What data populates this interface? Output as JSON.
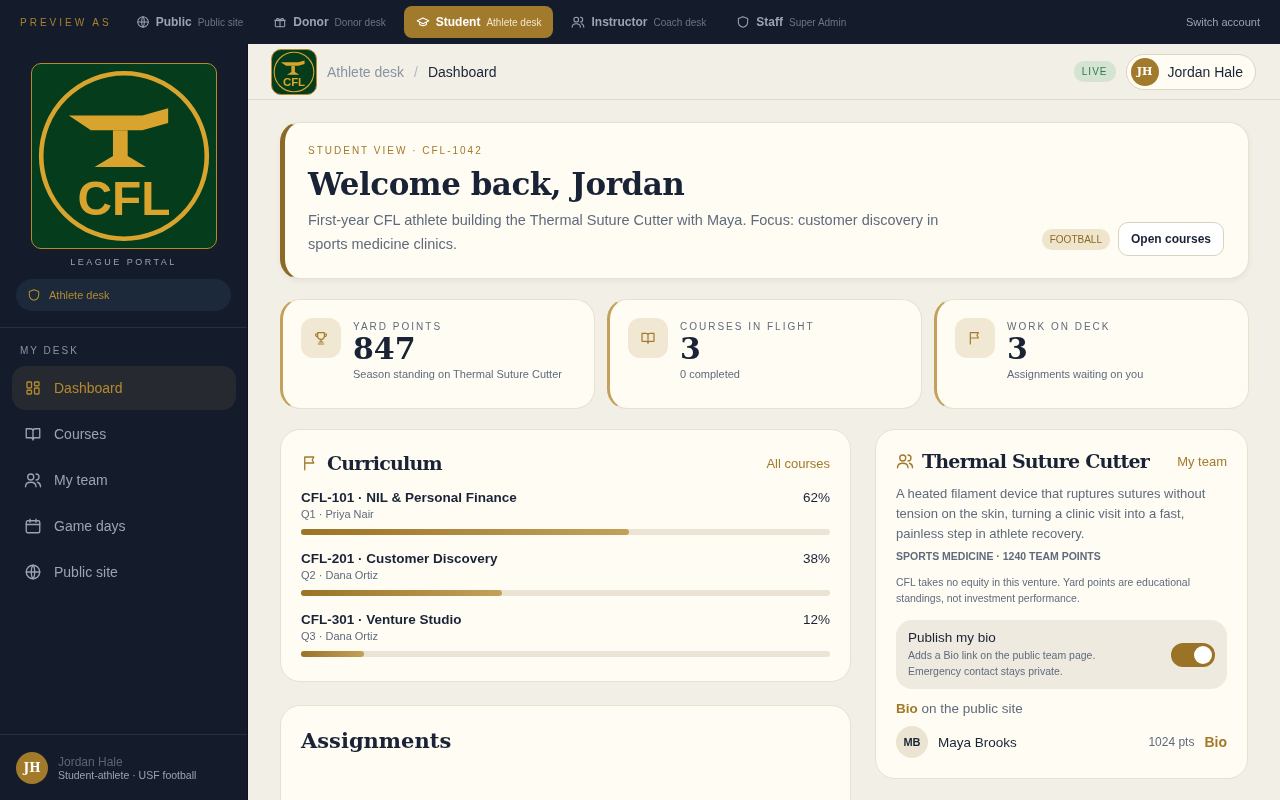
{
  "preview_bar": {
    "label": "PREVIEW AS",
    "roles": [
      {
        "name": "Public",
        "desk": "Public site",
        "selected": false
      },
      {
        "name": "Donor",
        "desk": "Donor desk",
        "selected": false
      },
      {
        "name": "Student",
        "desk": "Athlete desk",
        "selected": true
      },
      {
        "name": "Instructor",
        "desk": "Coach desk",
        "selected": false
      },
      {
        "name": "Staff",
        "desk": "Super Admin",
        "selected": false
      }
    ],
    "switch": "Switch account"
  },
  "sidebar": {
    "logo_text": "CFL",
    "portal": "LEAGUE PORTAL",
    "desk_pill": "Athlete desk",
    "section": "MY DESK",
    "items": [
      {
        "label": "Dashboard",
        "selected": true
      },
      {
        "label": "Courses",
        "selected": false
      },
      {
        "label": "My team",
        "selected": false
      },
      {
        "label": "Game days",
        "selected": false
      },
      {
        "label": "Public site",
        "selected": false
      }
    ],
    "user": {
      "initials": "JH",
      "name": "Jordan Hale",
      "role": "Student-athlete · USF football"
    }
  },
  "header": {
    "logo_text": "CFL",
    "breadcrumb": [
      "Athlete desk",
      "Dashboard"
    ],
    "separator": "/",
    "live": "LIVE",
    "user": {
      "initials": "JH",
      "name": "Jordan Hale"
    }
  },
  "hero": {
    "eyebrow": "STUDENT VIEW · CFL-1042",
    "title": "Welcome back, Jordan",
    "text": "First-year CFL athlete building the Thermal Suture Cutter with Maya. Focus: customer discovery in sports medicine clinics.",
    "tag": "FOOTBALL",
    "button": "Open courses"
  },
  "stats": [
    {
      "label": "YARD POINTS",
      "value": "847",
      "note": "Season standing on Thermal Suture Cutter"
    },
    {
      "label": "COURSES IN FLIGHT",
      "value": "3",
      "note": "0 completed"
    },
    {
      "label": "WORK ON DECK",
      "value": "3",
      "note": "Assignments waiting on you"
    }
  ],
  "curriculum": {
    "title": "Curriculum",
    "link": "All courses",
    "courses": [
      {
        "name": "CFL-101 · NIL & Personal Finance",
        "meta": "Q1 · Priya Nair",
        "percent": "62%",
        "level": 0.62
      },
      {
        "name": "CFL-201 · Customer Discovery",
        "meta": "Q2 · Dana Ortiz",
        "percent": "38%",
        "level": 0.38
      },
      {
        "name": "CFL-301 · Venture Studio",
        "meta": "Q3 · Dana Ortiz",
        "percent": "12%",
        "level": 0.12
      }
    ]
  },
  "assignments": {
    "title": "Assignments"
  },
  "team": {
    "title": "Thermal Suture Cutter",
    "link": "My team",
    "description": "A heated filament device that ruptures sutures without tension on the skin, turning a clinic visit into a fast, painless step in athlete recovery.",
    "meta": "SPORTS MEDICINE · 1240 TEAM POINTS",
    "disclaimer": "CFL takes no equity in this venture. Yard points are educational standings, not investment performance.",
    "publish": {
      "title": "Publish my bio",
      "text": "Adds a Bio link on the public team page. Emergency contact stays private.",
      "on": true
    },
    "bio_line": "**Bio** on the public site",
    "members": [
      {
        "initials": "MB",
        "name": "Maya Brooks",
        "points": "1024 pts",
        "link": "Bio"
      }
    ]
  }
}
